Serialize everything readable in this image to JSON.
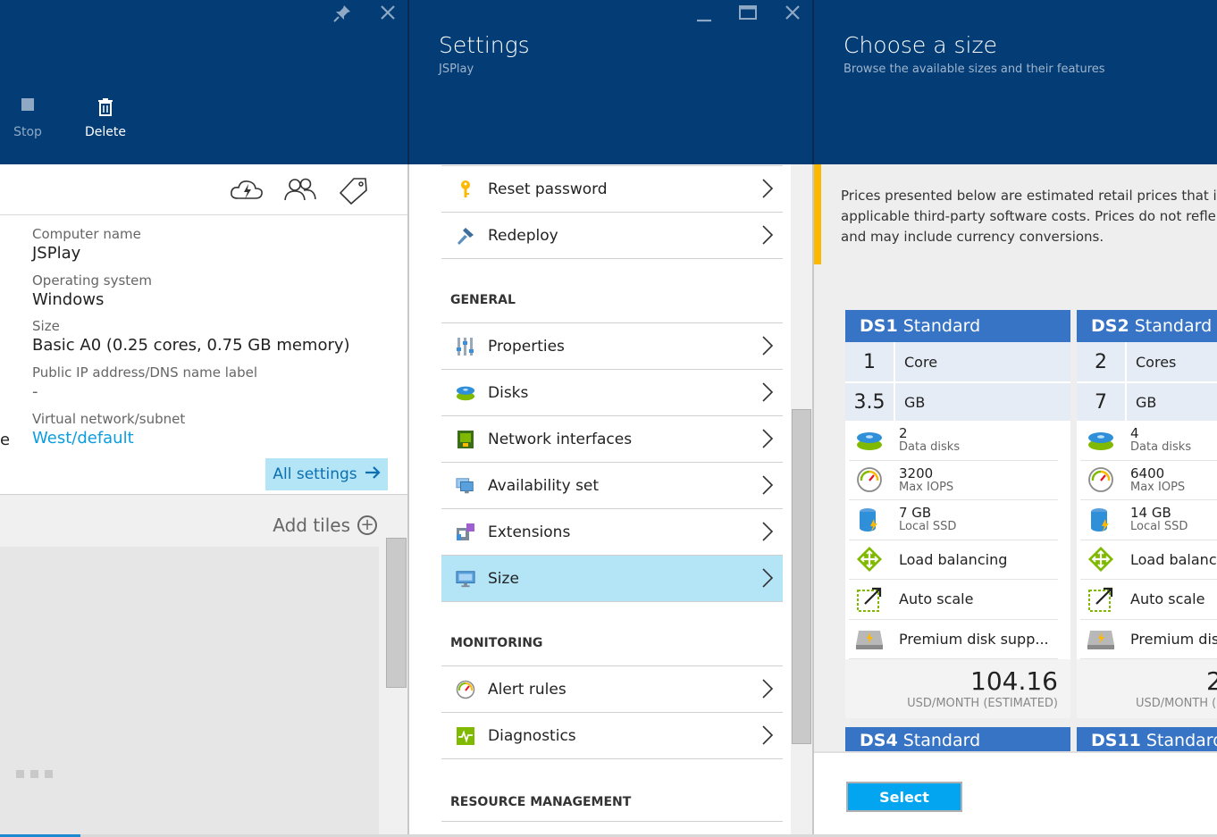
{
  "colors": {
    "header_bg": "#043d76",
    "accent": "#0b9de0",
    "selected_bg": "#b4e5f7",
    "card_header": "#3874c5",
    "notice_bar": "#fcb900",
    "select_button": "#04a5f0"
  },
  "blade1": {
    "commands": {
      "stop": "Stop",
      "delete": "Delete"
    },
    "essentials": {
      "computer_name_label": "Computer name",
      "computer_name": "JSPlay",
      "os_label": "Operating system",
      "os": "Windows",
      "size_label": "Size",
      "size": "Basic A0 (0.25 cores, 0.75 GB memory)",
      "ip_label": "Public IP address/DNS name label",
      "ip": "-",
      "vnet_label": "Virtual network/subnet",
      "vnet": "West/default",
      "left_edge_letter": "e"
    },
    "all_settings": "All settings",
    "add_tiles": "Add tiles"
  },
  "blade2": {
    "title": "Settings",
    "subtitle": "JSPlay",
    "top_items": [
      {
        "label": "Reset password",
        "icon": "key-icon"
      },
      {
        "label": "Redeploy",
        "icon": "hammer-icon"
      }
    ],
    "general": {
      "title": "GENERAL",
      "items": [
        {
          "label": "Properties",
          "icon": "properties-icon"
        },
        {
          "label": "Disks",
          "icon": "disks-icon"
        },
        {
          "label": "Network interfaces",
          "icon": "network-interfaces-icon"
        },
        {
          "label": "Availability set",
          "icon": "availability-set-icon"
        },
        {
          "label": "Extensions",
          "icon": "extensions-icon"
        },
        {
          "label": "Size",
          "icon": "size-monitor-icon",
          "selected": true
        }
      ]
    },
    "monitoring": {
      "title": "MONITORING",
      "items": [
        {
          "label": "Alert rules",
          "icon": "alert-gauge-icon"
        },
        {
          "label": "Diagnostics",
          "icon": "diagnostics-icon"
        }
      ]
    },
    "resource_management": {
      "title": "RESOURCE MANAGEMENT"
    }
  },
  "blade3": {
    "title": "Choose a size",
    "subtitle": "Browse the available sizes and their features",
    "notice": [
      "Prices presented below are estimated retail prices that i",
      "applicable third-party software costs. Prices do not refle",
      "and may include currency conversions."
    ],
    "cards": [
      {
        "name": "DS1",
        "tier": "Standard",
        "cores": "1",
        "cores_label": "Core",
        "memory": "3.5",
        "memory_label": "GB",
        "disks": "2",
        "disks_label": "Data disks",
        "iops": "3200",
        "iops_label": "Max IOPS",
        "ssd": "7 GB",
        "ssd_label": "Local SSD",
        "load_balancing": "Load balancing",
        "auto_scale": "Auto scale",
        "premium": "Premium disk supp...",
        "price": "104.16",
        "price_note": "USD/MONTH (ESTIMATED)"
      },
      {
        "name": "DS2",
        "tier": "Standard",
        "cores": "2",
        "cores_label": "Cores",
        "memory": "7",
        "memory_label": "GB",
        "disks": "4",
        "disks_label": "Data disks",
        "iops": "6400",
        "iops_label": "Max IOPS",
        "ssd": "14 GB",
        "ssd_label": "Local SSD",
        "load_balancing": "Load balancing",
        "auto_scale": "Auto scale",
        "premium": "Premium disk supp...",
        "price": "2",
        "price_note": "USD/MONTH ("
      }
    ],
    "next_cards": [
      {
        "name": "DS4",
        "tier": "Standard"
      },
      {
        "name": "DS11",
        "tier": "Standard"
      }
    ],
    "select": "Select"
  }
}
